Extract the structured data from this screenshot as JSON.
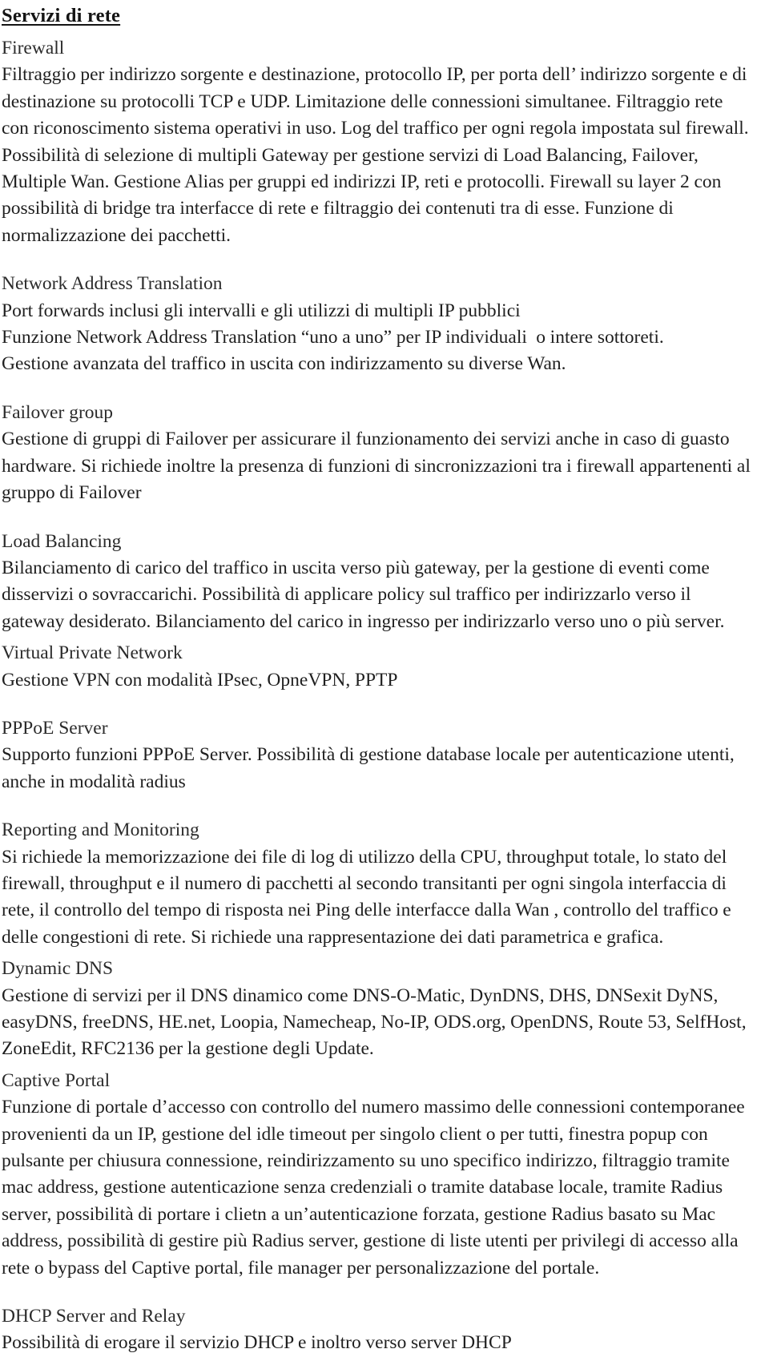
{
  "document": {
    "title": "Servizi di rete",
    "language": "it",
    "sections": [
      {
        "id": "firewall",
        "heading": "Firewall",
        "lines": [
          "Filtraggio per indirizzo sorgente e destinazione, protocollo IP, per porta dell’ indirizzo sorgente e di",
          "destinazione su protocolli TCP e UDP. Limitazione delle connessioni simultanee. Filtraggio rete",
          "con riconoscimento sistema operativi in uso. Log del traffico per ogni regola impostata sul firewall.",
          "Possibilità di selezione di multipli Gateway per gestione servizi di Load Balancing, Failover,",
          "Multiple Wan. Gestione Alias per gruppi ed indirizzi IP, reti e protocolli. Firewall su layer 2 con",
          "possibilità di bridge tra interfacce di rete e filtraggio dei contenuti tra di esse. Funzione di",
          "normalizzazione dei pacchetti."
        ]
      },
      {
        "id": "network-address-translation",
        "heading": "Network Address Translation",
        "lines": [
          "Port forwards inclusi gli intervalli e gli utilizzi di multipli IP pubblici",
          "Funzione Network Address Translation “uno a uno” per IP individuali  o intere sottoreti.",
          "Gestione avanzata del traffico in uscita con indirizzamento su diverse Wan."
        ]
      },
      {
        "id": "failover-group",
        "heading": "Failover group",
        "lines": [
          "Gestione di gruppi di Failover per assicurare il funzionamento dei servizi anche in caso di guasto",
          "hardware. Si richiede inoltre la presenza di funzioni di sincronizzazioni tra i firewall appartenenti al",
          "gruppo di Failover"
        ]
      },
      {
        "id": "load-balancing",
        "heading": "Load Balancing",
        "lines": [
          "Bilanciamento di carico del traffico in uscita verso più gateway, per la gestione di eventi come",
          "disservizi o sovraccarichi. Possibilità di applicare policy sul traffico per indirizzarlo verso il",
          "gateway desiderato. Bilanciamento del carico in ingresso per indirizzarlo verso uno o più server."
        ]
      },
      {
        "id": "virtual-private-network",
        "heading": "Virtual Private Network",
        "lines": [
          "Gestione VPN con modalità IPsec, OpneVPN, PPTP"
        ]
      },
      {
        "id": "pppoe-server",
        "heading": "PPPoE Server",
        "lines": [
          "Supporto funzioni PPPoE Server. Possibilità di gestione database locale per autenticazione utenti,",
          "anche in modalità radius"
        ]
      },
      {
        "id": "reporting-and-monitoring",
        "heading": "Reporting and Monitoring",
        "lines": [
          "Si richiede la memorizzazione dei file di log di utilizzo della CPU, throughput totale, lo stato del",
          "firewall, throughput e il numero di pacchetti al secondo transitanti per ogni singola interfaccia di",
          "rete, il controllo del tempo di risposta nei Ping delle interfacce dalla Wan , controllo del traffico e",
          "delle congestioni di rete. Si richiede una rappresentazione dei dati parametrica e grafica."
        ]
      },
      {
        "id": "dynamic-dns",
        "heading": "Dynamic DNS",
        "lines": [
          "Gestione di servizi per il DNS dinamico come DNS-O-Matic, DynDNS, DHS, DNSexit DyNS,",
          "easyDNS, freeDNS, HE.net, Loopia, Namecheap, No-IP, ODS.org, OpenDNS, Route 53, SelfHost,",
          "ZoneEdit, RFC2136 per la gestione degli Update."
        ]
      },
      {
        "id": "captive-portal",
        "heading": "Captive Portal",
        "lines": [
          "Funzione di portale d’accesso con controllo del numero massimo delle connessioni contemporanee",
          "provenienti da un IP, gestione del idle timeout per singolo client o per tutti, finestra popup con",
          "pulsante per chiusura connessione, reindirizzamento su uno specifico indirizzo, filtraggio tramite",
          "mac address, gestione autenticazione senza credenziali o tramite database locale, tramite Radius",
          "server, possibilità di portare i clietn a un’autenticazione forzata, gestione Radius basato su Mac",
          "address, possibilità di gestire più Radius server, gestione di liste utenti per privilegi di accesso alla",
          "rete o bypass del Captive portal, file manager per personalizzazione del portale."
        ]
      },
      {
        "id": "dhcp-server-and-relay",
        "heading": "DHCP Server and Relay",
        "lines": [
          "Possibilità di erogare il servizio DHCP e inoltro verso server DHCP"
        ]
      }
    ]
  }
}
